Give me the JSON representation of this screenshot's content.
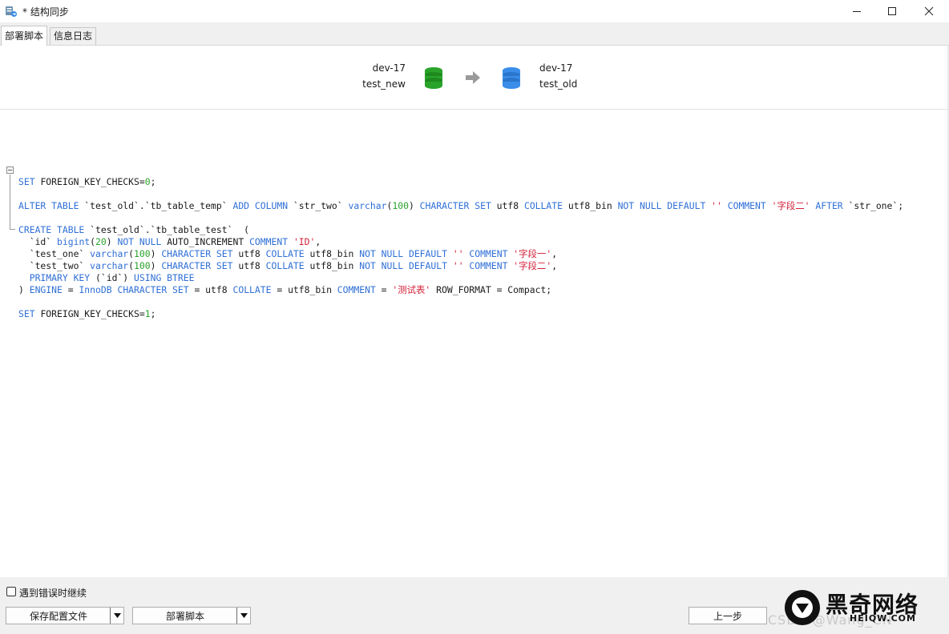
{
  "window": {
    "title": "* 结构同步",
    "controls": [
      "minimize",
      "maximize",
      "close"
    ]
  },
  "tabs": [
    {
      "label": "部署脚本",
      "active": true
    },
    {
      "label": "信息日志",
      "active": false
    }
  ],
  "source": {
    "connection": "dev-17",
    "database": "test_new",
    "icon_color": "#2aa32a"
  },
  "target": {
    "connection": "dev-17",
    "database": "test_old",
    "icon_color": "#3a8de8"
  },
  "arrow_icon": "arrow-right-icon",
  "colors": {
    "keyword": "#2f6fd6",
    "number": "#2aa32a",
    "string": "#d3213a"
  },
  "script_lines": [
    [
      [
        "kw",
        "SET "
      ],
      [
        "pl",
        "FOREIGN_KEY_CHECKS="
      ],
      [
        "num",
        "0"
      ],
      [
        "pl",
        ";"
      ]
    ],
    [],
    [
      [
        "kw",
        "ALTER TABLE "
      ],
      [
        "pl",
        "`test_old`.`tb_table_temp` "
      ],
      [
        "kw",
        "ADD COLUMN "
      ],
      [
        "pl",
        "`str_two` "
      ],
      [
        "kw",
        "varchar"
      ],
      [
        "pl",
        "("
      ],
      [
        "num",
        "100"
      ],
      [
        "pl",
        ") "
      ],
      [
        "kw",
        "CHARACTER SET "
      ],
      [
        "pl",
        "utf8 "
      ],
      [
        "kw",
        "COLLATE "
      ],
      [
        "pl",
        "utf8_bin "
      ],
      [
        "kw",
        "NOT NULL DEFAULT "
      ],
      [
        "str",
        "'' "
      ],
      [
        "kw",
        "COMMENT "
      ],
      [
        "str",
        "'字段二' "
      ],
      [
        "kw",
        "AFTER "
      ],
      [
        "pl",
        "`str_one`;"
      ]
    ],
    [],
    [
      [
        "kw",
        "CREATE TABLE "
      ],
      [
        "pl",
        "`test_old`.`tb_table_test`  ("
      ]
    ],
    [
      [
        "pl",
        "  `id` "
      ],
      [
        "kw",
        "bigint"
      ],
      [
        "pl",
        "("
      ],
      [
        "num",
        "20"
      ],
      [
        "pl",
        ") "
      ],
      [
        "kw",
        "NOT NULL "
      ],
      [
        "pl",
        "AUTO_INCREMENT "
      ],
      [
        "kw",
        "COMMENT "
      ],
      [
        "str",
        "'ID'"
      ],
      [
        "pl",
        ","
      ]
    ],
    [
      [
        "pl",
        "  `test_one` "
      ],
      [
        "kw",
        "varchar"
      ],
      [
        "pl",
        "("
      ],
      [
        "num",
        "100"
      ],
      [
        "pl",
        ") "
      ],
      [
        "kw",
        "CHARACTER SET "
      ],
      [
        "pl",
        "utf8 "
      ],
      [
        "kw",
        "COLLATE "
      ],
      [
        "pl",
        "utf8_bin "
      ],
      [
        "kw",
        "NOT NULL DEFAULT "
      ],
      [
        "str",
        "'' "
      ],
      [
        "kw",
        "COMMENT "
      ],
      [
        "str",
        "'字段一'"
      ],
      [
        "pl",
        ","
      ]
    ],
    [
      [
        "pl",
        "  `test_two` "
      ],
      [
        "kw",
        "varchar"
      ],
      [
        "pl",
        "("
      ],
      [
        "num",
        "100"
      ],
      [
        "pl",
        ") "
      ],
      [
        "kw",
        "CHARACTER SET "
      ],
      [
        "pl",
        "utf8 "
      ],
      [
        "kw",
        "COLLATE "
      ],
      [
        "pl",
        "utf8_bin "
      ],
      [
        "kw",
        "NOT NULL DEFAULT "
      ],
      [
        "str",
        "'' "
      ],
      [
        "kw",
        "COMMENT "
      ],
      [
        "str",
        "'字段二'"
      ],
      [
        "pl",
        ","
      ]
    ],
    [
      [
        "kw",
        "  PRIMARY KEY "
      ],
      [
        "pl",
        "(`id`) "
      ],
      [
        "kw",
        "USING BTREE"
      ]
    ],
    [
      [
        "pl",
        ") "
      ],
      [
        "kw",
        "ENGINE "
      ],
      [
        "pl",
        "= "
      ],
      [
        "kw",
        "InnoDB CHARACTER SET "
      ],
      [
        "pl",
        "= utf8 "
      ],
      [
        "kw",
        "COLLATE "
      ],
      [
        "pl",
        "= utf8_bin "
      ],
      [
        "kw",
        "COMMENT "
      ],
      [
        "pl",
        "= "
      ],
      [
        "str",
        "'测试表' "
      ],
      [
        "pl",
        "ROW_FORMAT = Compact;"
      ]
    ],
    [],
    [
      [
        "kw",
        "SET "
      ],
      [
        "pl",
        "FOREIGN_KEY_CHECKS="
      ],
      [
        "num",
        "1"
      ],
      [
        "pl",
        ";"
      ]
    ]
  ],
  "bottom": {
    "continue_on_error_label": "遇到错误时继续",
    "continue_on_error_checked": false,
    "save_config_label": "保存配置文件",
    "deploy_script_label": "部署脚本",
    "back_label": "上一步"
  },
  "watermark": {
    "brand_cn": "黑奇网络",
    "brand_en": "HEIQW.COM",
    "csdn": "CSDN @Wang_CN"
  }
}
